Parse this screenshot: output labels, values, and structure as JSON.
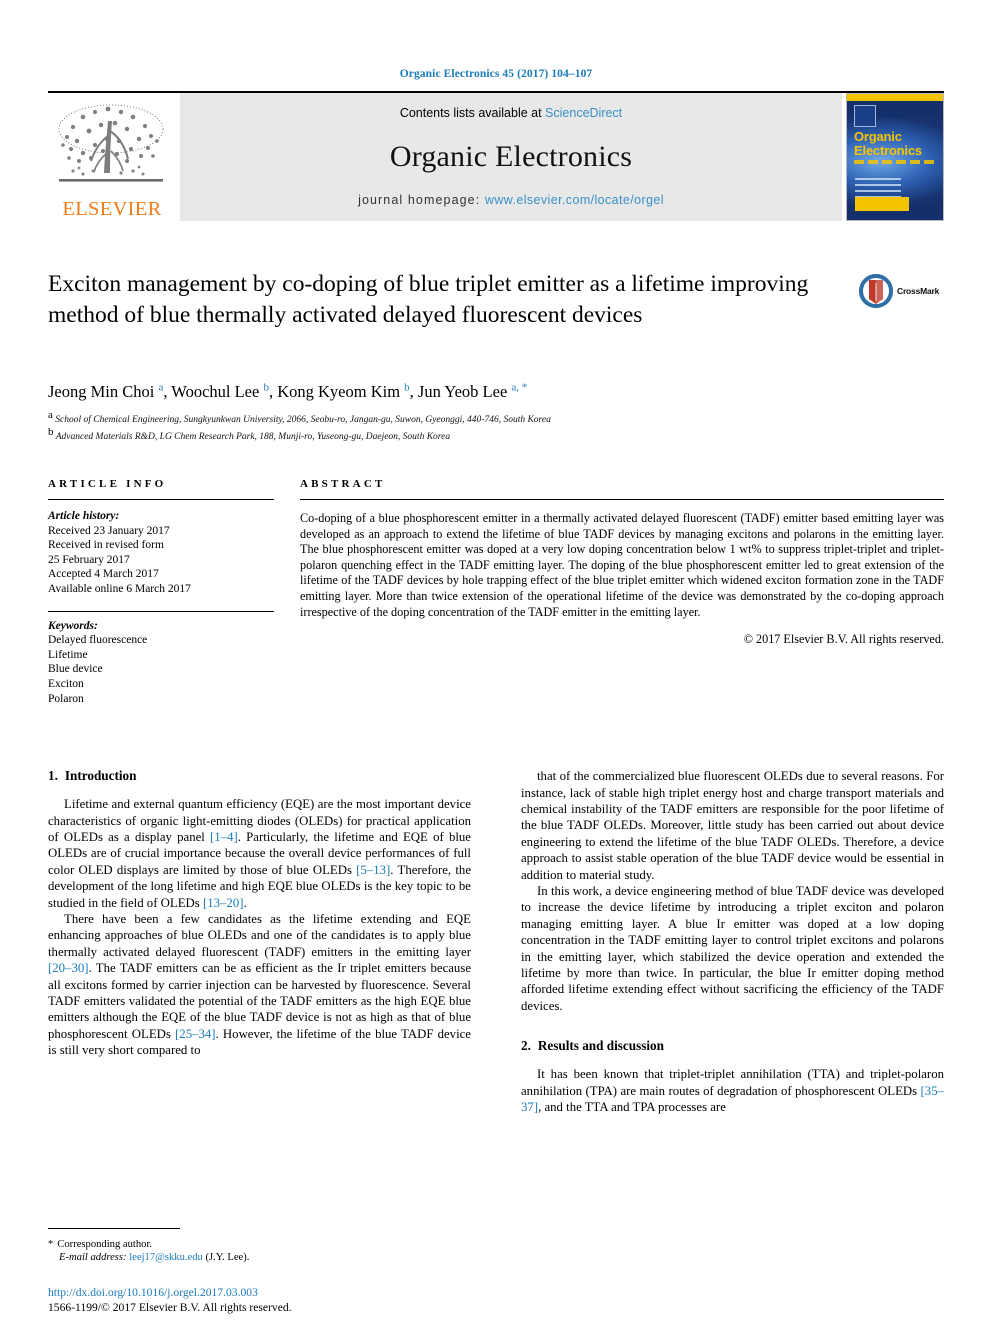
{
  "running_head": "Organic Electronics 45 (2017) 104–107",
  "masthead": {
    "publisher_logo_text": "ELSEVIER",
    "contents_prefix": "Contents lists available at ",
    "contents_link": "ScienceDirect",
    "journal_name": "Organic Electronics",
    "homepage_prefix": "journal homepage: ",
    "homepage_url": "www.elsevier.com/locate/orgel",
    "cover": {
      "title_line1": "Organic",
      "title_line2": "Electronics"
    }
  },
  "article": {
    "title": "Exciton management by co-doping of blue triplet emitter as a lifetime improving method of blue thermally activated delayed fluorescent devices",
    "crossmark_label": "CrossMark",
    "authors_html": "Jeong Min Choi <sup>a</sup>, Woochul Lee <sup>b</sup>, Kong Kyeom Kim <sup>b</sup>, Jun Yeob Lee <sup>a, *</sup>",
    "affiliations": [
      "School of Chemical Engineering, Sungkyunkwan University, 2066, Seobu-ro, Jangan-gu, Suwon, Gyeonggi, 440-746, South Korea",
      "Advanced Materials R&D, LG Chem Research Park, 188, Munji-ro, Yuseong-gu, Daejeon, South Korea"
    ],
    "affiliation_markers": [
      "a",
      "b"
    ]
  },
  "article_info": {
    "heading": "ARTICLE INFO",
    "history_label": "Article history:",
    "history": [
      "Received 23 January 2017",
      "Received in revised form",
      "25 February 2017",
      "Accepted 4 March 2017",
      "Available online 6 March 2017"
    ],
    "keywords_label": "Keywords:",
    "keywords": [
      "Delayed fluorescence",
      "Lifetime",
      "Blue device",
      "Exciton",
      "Polaron"
    ]
  },
  "abstract": {
    "heading": "ABSTRACT",
    "text": "Co-doping of a blue phosphorescent emitter in a thermally activated delayed fluorescent (TADF) emitter based emitting layer was developed as an approach to extend the lifetime of blue TADF devices by managing excitons and polarons in the emitting layer. The blue phosphorescent emitter was doped at a very low doping concentration below 1 wt% to suppress triplet-triplet and triplet-polaron quenching effect in the TADF emitting layer. The doping of the blue phosphorescent emitter led to great extension of the lifetime of the TADF devices by hole trapping effect of the blue triplet emitter which widened exciton formation zone in the TADF emitting layer. More than twice extension of the operational lifetime of the device was demonstrated by the co-doping approach irrespective of the doping concentration of the TADF emitter in the emitting layer.",
    "copyright": "© 2017 Elsevier B.V. All rights reserved."
  },
  "sections": {
    "introduction": {
      "number": "1.",
      "title": "Introduction"
    },
    "results": {
      "number": "2.",
      "title": "Results and discussion"
    }
  },
  "body": {
    "left_paragraphs": [
      {
        "parts": [
          {
            "t": "Lifetime and external quantum efficiency (EQE) are the most important device characteristics of organic light-emitting diodes (OLEDs) for practical application of OLEDs as a display panel "
          },
          {
            "t": "[1–4]",
            "ref": true
          },
          {
            "t": ". Particularly, the lifetime and EQE of blue OLEDs are of crucial importance because the overall device performances of full color OLED displays are limited by those of blue OLEDs "
          },
          {
            "t": "[5–13]",
            "ref": true
          },
          {
            "t": ". Therefore, the development of the long lifetime and high EQE blue OLEDs is the key topic to be studied in the field of OLEDs "
          },
          {
            "t": "[13–20]",
            "ref": true
          },
          {
            "t": "."
          }
        ]
      },
      {
        "parts": [
          {
            "t": "There have been a few candidates as the lifetime extending and EQE enhancing approaches of blue OLEDs and one of the candidates is to apply blue thermally activated delayed fluorescent (TADF) emitters in the emitting layer "
          },
          {
            "t": "[20–30]",
            "ref": true
          },
          {
            "t": ". The TADF emitters can be as efficient as the Ir triplet emitters because all excitons formed by carrier injection can be harvested by fluorescence. Several TADF emitters validated the potential of the TADF emitters as the high EQE blue emitters although the EQE of the blue TADF device is not as high as that of blue phosphorescent OLEDs "
          },
          {
            "t": "[25–34]",
            "ref": true
          },
          {
            "t": ". However, the lifetime of the blue TADF device is still very short compared to"
          }
        ]
      }
    ],
    "right_paragraphs": [
      {
        "parts": [
          {
            "t": "that of the commercialized blue fluorescent OLEDs due to several reasons. For instance, lack of stable high triplet energy host and charge transport materials and chemical instability of the TADF emitters are responsible for the poor lifetime of the blue TADF OLEDs. Moreover, little study has been carried out about device engineering to extend the lifetime of the blue TADF OLEDs. Therefore, a device approach to assist stable operation of the blue TADF device would be essential in addition to material study."
          }
        ]
      },
      {
        "parts": [
          {
            "t": "In this work, a device engineering method of blue TADF device was developed to increase the device lifetime by introducing a triplet exciton and polaron managing emitting layer. A blue Ir emitter was doped at a low doping concentration in the TADF emitting layer to control triplet excitons and polarons in the emitting layer, which stabilized the device operation and extended the lifetime by more than twice. In particular, the blue Ir emitter doping method afforded lifetime extending effect without sacrificing the efficiency of the TADF devices."
          }
        ]
      }
    ],
    "results_paragraphs": [
      {
        "parts": [
          {
            "t": "It has been known that triplet-triplet annihilation (TTA) and triplet-polaron annihilation (TPA) are main routes of degradation of phosphorescent OLEDs "
          },
          {
            "t": "[35–37]",
            "ref": true
          },
          {
            "t": ", and the TTA and TPA processes are"
          }
        ]
      }
    ]
  },
  "footnote": {
    "star": "*",
    "corresponding": "Corresponding author.",
    "email_label": "E-mail address:",
    "email": "leej17@skku.edu",
    "email_suffix": "(J.Y. Lee)."
  },
  "footer": {
    "doi": "http://dx.doi.org/10.1016/j.orgel.2017.03.003",
    "issn_line": "1566-1199/© 2017 Elsevier B.V. All rights reserved."
  },
  "colors": {
    "link_blue": "#1a7bb9",
    "elsevier_orange": "#ef7d1a",
    "masthead_gray": "#e8e8e8"
  }
}
